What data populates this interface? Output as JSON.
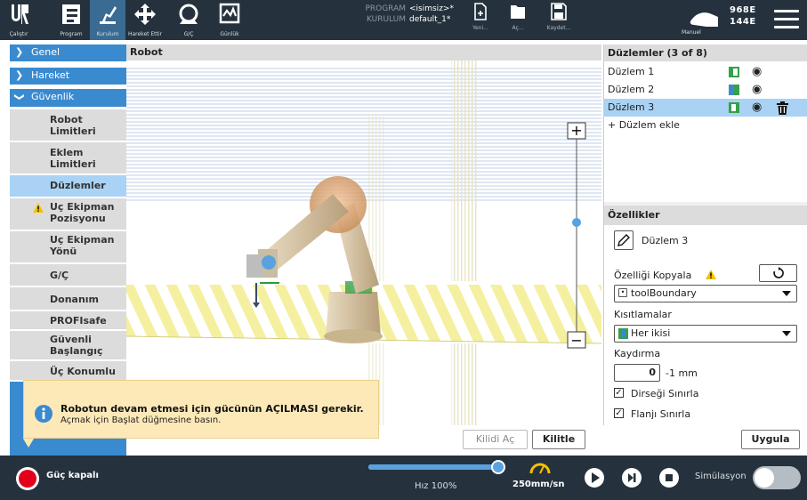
{
  "topbar": {
    "nav": [
      {
        "label": "Çalıştır"
      },
      {
        "label": "Program"
      },
      {
        "label": "Kurulum"
      },
      {
        "label": "Hareket Ettir"
      },
      {
        "label": "G/Ç"
      },
      {
        "label": "Günlük"
      }
    ],
    "program_key": "PROGRAM",
    "program_value": "<isimsiz>*",
    "installation_key": "KURULUM",
    "installation_value": "default_1*",
    "file_new": "Yeni...",
    "file_open": "Aç...",
    "file_save": "Kaydet...",
    "mode_label": "Manuel",
    "speed_line1": "968E",
    "speed_line2": "144E"
  },
  "sidebar": {
    "general": "Genel",
    "motion": "Hareket",
    "safety": "Güvenlik",
    "items": [
      "Robot Limitleri",
      "Eklem Limitleri",
      "Düzlemler",
      "Uç Ekipman Pozisyonu",
      "Uç Ekipman Yönü",
      "G/Ç",
      "Donanım",
      "PROFIsafe",
      "Güvenli Başlangıç",
      "Üç Konumlu"
    ]
  },
  "viewport": {
    "title": "Robot"
  },
  "planes": {
    "header": "Düzlemler (3 of 8)",
    "items": [
      "Düzlem 1",
      "Düzlem 2",
      "Düzlem 3"
    ],
    "add_label": "+ Düzlem ekle"
  },
  "properties": {
    "header": "Özellikler",
    "name": "Düzlem 3",
    "copy_feature_label": "Özelliği Kopyala",
    "feature_value": "toolBoundary",
    "restriction_label": "Kısıtlamalar",
    "restriction_value": "Her ikisi",
    "offset_label": "Kaydırma",
    "offset_value": "0",
    "offset_unit": "-1 mm",
    "restrict_elbow": "Dirseği Sınırla",
    "restrict_flange": "Flanjı Sınırla",
    "apply_label": "Uygula"
  },
  "unlock_label": "Kilidi Aç",
  "lock_label": "Kilitle",
  "popup": {
    "line1": "Robotun devam etmesi için gücünün AÇILMASI gerekir.",
    "line2": "Açmak için Başlat düğmesine basın."
  },
  "bottombar": {
    "power_label": "Güç kapalı",
    "speed_label": "Hız 100%",
    "speed_percent": 100,
    "tcp_speed": "250mm/sn",
    "simulation_label": "Simülasyon"
  }
}
